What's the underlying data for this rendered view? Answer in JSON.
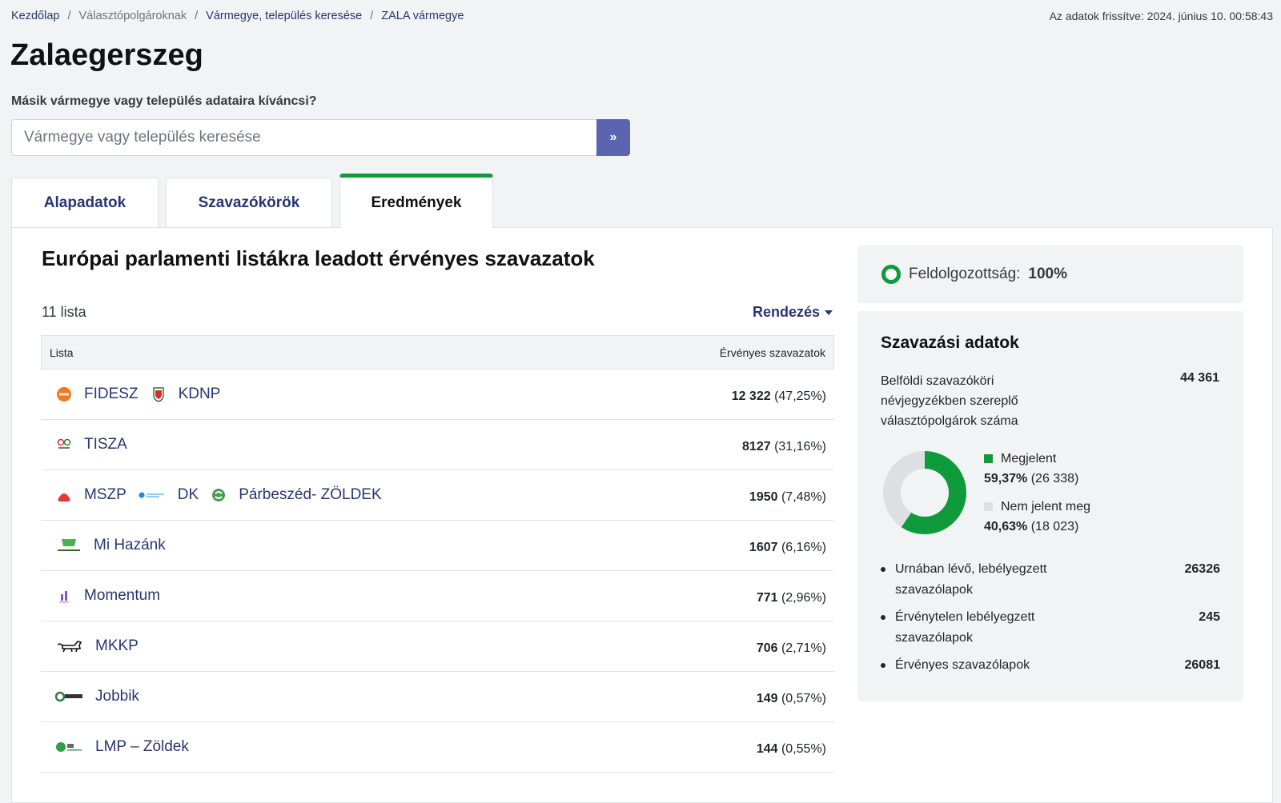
{
  "breadcrumb": {
    "home": "Kezdőlap",
    "voters": "Választópolgároknak",
    "search": "Vármegye, település keresése",
    "county": "ZALA vármegye"
  },
  "updated": "Az adatok frissítve: 2024. június 10. 00:58:43",
  "title": "Zalaegerszeg",
  "search": {
    "label": "Másik vármegye vagy település adataira kíváncsi?",
    "placeholder": "Vármegye vagy település keresése",
    "button": "»"
  },
  "tabs": [
    "Alapadatok",
    "Szavazókörök",
    "Eredmények"
  ],
  "results": {
    "title": "Európai parlamenti listákra leadott érvényes szavazatok",
    "count": "11 lista",
    "sort": "Rendezés",
    "col_list": "Lista",
    "col_votes": "Érvényes szavazatok",
    "rows": [
      {
        "parties": [
          "FIDESZ",
          "KDNP"
        ],
        "votes": "12 322",
        "pct": "(47,25%)"
      },
      {
        "parties": [
          "TISZA"
        ],
        "votes": "8127",
        "pct": "(31,16%)"
      },
      {
        "parties": [
          "MSZP",
          "DK",
          "Párbeszéd- ZÖLDEK"
        ],
        "votes": "1950",
        "pct": "(7,48%)"
      },
      {
        "parties": [
          "Mi Hazánk"
        ],
        "votes": "1607",
        "pct": "(6,16%)"
      },
      {
        "parties": [
          "Momentum"
        ],
        "votes": "771",
        "pct": "(2,96%)"
      },
      {
        "parties": [
          "MKKP"
        ],
        "votes": "706",
        "pct": "(2,71%)"
      },
      {
        "parties": [
          "Jobbik"
        ],
        "votes": "149",
        "pct": "(0,57%)"
      },
      {
        "parties": [
          "LMP – Zöldek"
        ],
        "votes": "144",
        "pct": "(0,55%)"
      }
    ]
  },
  "progress": {
    "label": "Feldolgozottság:",
    "value": "100%"
  },
  "voting": {
    "title": "Szavazási adatok",
    "registered_label": "Belföldi szavazóköri névjegyzékben szereplő választópolgárok száma",
    "registered_value": "44 361",
    "present_label": "Megjelent",
    "present_pct": "59,37%",
    "present_count": "(26 338)",
    "absent_label": "Nem jelent meg",
    "absent_pct": "40,63%",
    "absent_count": "(18 023)",
    "present_fraction": 0.5937,
    "colors": {
      "present": "#0f9a3c",
      "absent": "#dde0e3"
    },
    "stats": [
      {
        "label": "Urnában lévő, lebélyegzett szavazólapok",
        "value": "26326"
      },
      {
        "label": "Érvénytelen lebélyegzett szavazólapok",
        "value": "245"
      },
      {
        "label": "Érvényes szavazólapok",
        "value": "26081"
      }
    ]
  }
}
